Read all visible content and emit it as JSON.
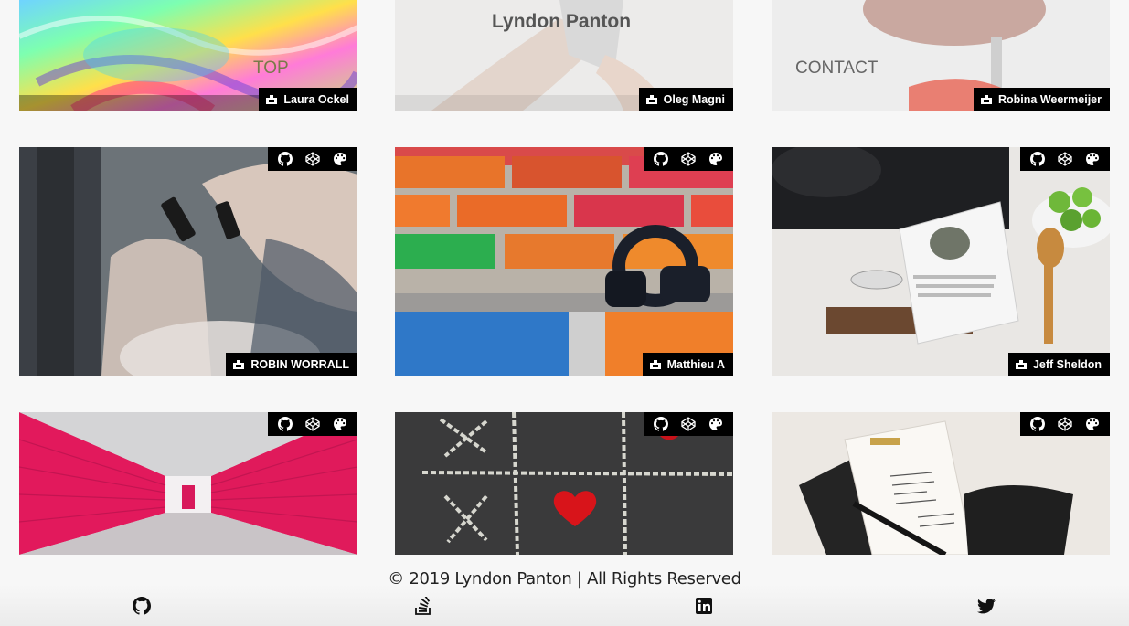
{
  "nav": {
    "brand": "Lyndon Panton",
    "top_link": "TOP",
    "contact_link": "CONTACT"
  },
  "tiles": [
    {
      "credit": "Laura Ockel",
      "image": "rainbow-rose-photo"
    },
    {
      "credit": "Oleg Magni",
      "image": "hands-phone-photo"
    },
    {
      "credit": "Robina Weermeijer",
      "image": "brain-model-photo"
    },
    {
      "credit": "ROBIN WORRALL",
      "image": "people-using-phones-photo"
    },
    {
      "credit": "Matthieu A",
      "image": "headphones-on-colored-bricks-photo"
    },
    {
      "credit": "Jeff Sheldon",
      "image": "ipad-recipe-kitchen-photo"
    },
    {
      "credit": "",
      "image": "pink-storage-hallway-photo"
    },
    {
      "credit": "",
      "image": "tic-tac-toe-heart-chalk-photo"
    },
    {
      "credit": "",
      "image": "clipboard-notes-pen-photo"
    }
  ],
  "tile_icons": [
    "github-icon",
    "codepen-icon",
    "palette-icon"
  ],
  "footer": {
    "copyright": "© 2019 Lyndon Panton | All Rights Reserved",
    "social": [
      "github-icon",
      "stackoverflow-icon",
      "linkedin-icon",
      "twitter-icon"
    ]
  }
}
